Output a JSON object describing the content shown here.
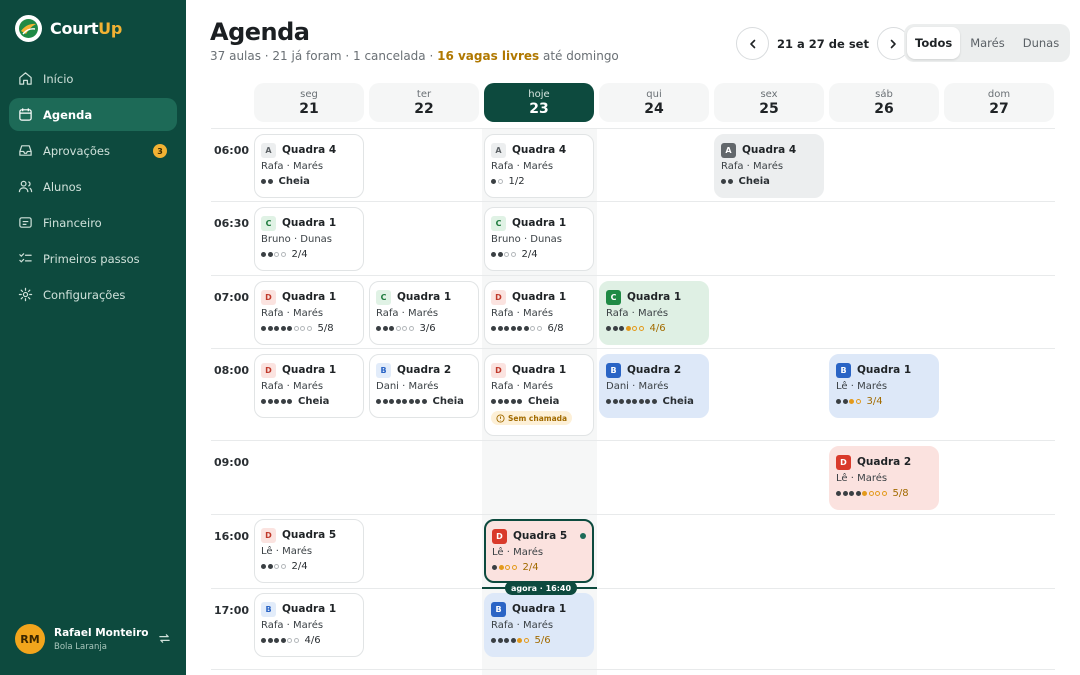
{
  "brand": {
    "name_main": "Court",
    "name_accent": "Up"
  },
  "nav": [
    {
      "label": "Início",
      "icon": "home-icon"
    },
    {
      "label": "Agenda",
      "icon": "calendar-icon",
      "active": true
    },
    {
      "label": "Aprovações",
      "icon": "inbox-icon",
      "badge": "3"
    },
    {
      "label": "Alunos",
      "icon": "users-icon"
    },
    {
      "label": "Financeiro",
      "icon": "wallet-icon"
    },
    {
      "label": "Primeiros passos",
      "icon": "checklist-icon"
    },
    {
      "label": "Configurações",
      "icon": "gear-icon"
    }
  ],
  "user": {
    "initials": "RM",
    "name": "Rafael Monteiro",
    "org": "Bola Laranja"
  },
  "header": {
    "title": "Agenda",
    "subtitle_pre": "37 aulas · 21 já foram · 1 cancelada · ",
    "subtitle_highlight": "16 vagas livres",
    "subtitle_post": " até domingo",
    "week_label": "21 a 27 de set",
    "filters": [
      "Todos",
      "Marés",
      "Dunas"
    ],
    "active_filter": "Todos"
  },
  "days": [
    {
      "name": "seg",
      "date": "21"
    },
    {
      "name": "ter",
      "date": "22"
    },
    {
      "name": "hoje",
      "date": "23",
      "today": true
    },
    {
      "name": "qui",
      "date": "24"
    },
    {
      "name": "sex",
      "date": "25"
    },
    {
      "name": "sáb",
      "date": "26"
    },
    {
      "name": "dom",
      "date": "27"
    }
  ],
  "times": [
    "06:00",
    "06:30",
    "07:00",
    "08:00",
    "09:00",
    "16:00",
    "17:00"
  ],
  "classes": [
    {
      "day": 0,
      "slot": 0,
      "level": "A",
      "court": "Quadra 4",
      "coach_place": "Rafa · Marés",
      "filled": 2,
      "capacity": 2,
      "count": "Cheia",
      "style": "plain"
    },
    {
      "day": 2,
      "slot": 0,
      "level": "A",
      "court": "Quadra 4",
      "coach_place": "Rafa · Marés",
      "filled": 1,
      "capacity": 2,
      "count": "1/2",
      "style": "plain"
    },
    {
      "day": 4,
      "slot": 0,
      "level": "A",
      "court": "Quadra 4",
      "coach_place": "Rafa · Marés",
      "filled": 2,
      "capacity": 2,
      "count": "Cheia",
      "style": "full"
    },
    {
      "day": 0,
      "slot": 1,
      "level": "C",
      "court": "Quadra 1",
      "coach_place": "Bruno · Dunas",
      "filled": 2,
      "capacity": 4,
      "count": "2/4",
      "style": "plain"
    },
    {
      "day": 2,
      "slot": 1,
      "level": "C",
      "court": "Quadra 1",
      "coach_place": "Bruno · Dunas",
      "filled": 2,
      "capacity": 4,
      "count": "2/4",
      "style": "plain"
    },
    {
      "day": 0,
      "slot": 2,
      "level": "D",
      "court": "Quadra 1",
      "coach_place": "Rafa · Marés",
      "filled": 5,
      "capacity": 8,
      "count": "5/8",
      "style": "plain"
    },
    {
      "day": 1,
      "slot": 2,
      "level": "C",
      "court": "Quadra 1",
      "coach_place": "Rafa · Marés",
      "filled": 3,
      "capacity": 6,
      "count": "3/6",
      "style": "plain"
    },
    {
      "day": 2,
      "slot": 2,
      "level": "D",
      "court": "Quadra 1",
      "coach_place": "Rafa · Marés",
      "filled": 6,
      "capacity": 8,
      "count": "6/8",
      "style": "plain"
    },
    {
      "day": 3,
      "slot": 2,
      "level": "C",
      "court": "Quadra 1",
      "coach_place": "Rafa · Marés",
      "filled": 4,
      "capacity": 6,
      "count": "4/6",
      "style": "g"
    },
    {
      "day": 0,
      "slot": 3,
      "level": "D",
      "court": "Quadra 1",
      "coach_place": "Rafa · Marés",
      "filled": 5,
      "capacity": 5,
      "count": "Cheia",
      "style": "plain"
    },
    {
      "day": 1,
      "slot": 3,
      "level": "B",
      "court": "Quadra 2",
      "coach_place": "Dani · Marés",
      "filled": 8,
      "capacity": 8,
      "count": "Cheia",
      "style": "plain"
    },
    {
      "day": 2,
      "slot": 3,
      "level": "D",
      "court": "Quadra 1",
      "coach_place": "Rafa · Marés",
      "filled": 5,
      "capacity": 5,
      "count": "Cheia",
      "style": "plain",
      "tag": "Sem chamada"
    },
    {
      "day": 3,
      "slot": 3,
      "level": "B",
      "court": "Quadra 2",
      "coach_place": "Dani · Marés",
      "filled": 8,
      "capacity": 8,
      "count": "Cheia",
      "style": "b"
    },
    {
      "day": 5,
      "slot": 3,
      "level": "B",
      "court": "Quadra 1",
      "coach_place": "Lê · Marés",
      "filled": 3,
      "capacity": 4,
      "count": "3/4",
      "style": "b"
    },
    {
      "day": 5,
      "slot": 4,
      "level": "D",
      "court": "Quadra 2",
      "coach_place": "Lê · Marés",
      "filled": 5,
      "capacity": 8,
      "count": "5/8",
      "style": "r"
    },
    {
      "day": 0,
      "slot": 5,
      "level": "D",
      "court": "Quadra 5",
      "coach_place": "Lê · Marés",
      "filled": 2,
      "capacity": 4,
      "count": "2/4",
      "style": "plain"
    },
    {
      "day": 2,
      "slot": 5,
      "level": "D",
      "court": "Quadra 5",
      "coach_place": "Lê · Marés",
      "filled": 2,
      "capacity": 4,
      "count": "2/4",
      "style": "cur",
      "live": true
    },
    {
      "day": 0,
      "slot": 6,
      "level": "B",
      "court": "Quadra 1",
      "coach_place": "Rafa · Marés",
      "filled": 4,
      "capacity": 6,
      "count": "4/6",
      "style": "plain"
    },
    {
      "day": 2,
      "slot": 6,
      "level": "B",
      "court": "Quadra 1",
      "coach_place": "Rafa · Marés",
      "filled": 5,
      "capacity": 6,
      "count": "5/6",
      "style": "b"
    }
  ],
  "now_label": "agora · 16:40",
  "colors": {
    "sidebar": "#0d4a3e",
    "accent": "#f2b233",
    "today": "#0d4a3e"
  }
}
